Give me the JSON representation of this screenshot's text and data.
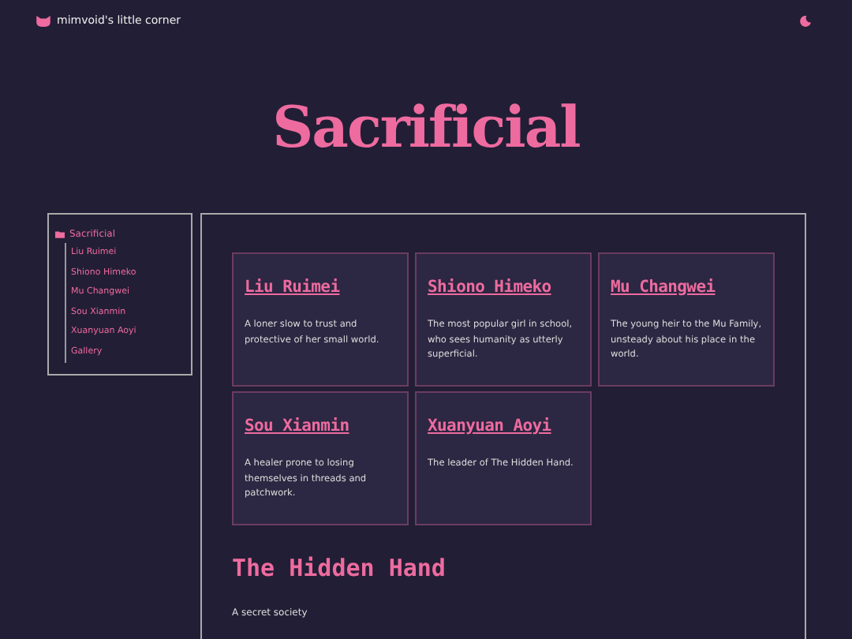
{
  "header": {
    "site_title": "mimvoid's little corner"
  },
  "page_title": "Sacrificial",
  "sidebar": {
    "items": [
      {
        "label": "Sacrificial",
        "children": [
          {
            "label": "Liu Ruimei"
          },
          {
            "label": "Shiono Himeko"
          },
          {
            "label": "Mu Changwei"
          },
          {
            "label": "Sou Xianmin"
          },
          {
            "label": "Xuanyuan Aoyi"
          },
          {
            "label": "Gallery"
          }
        ]
      }
    ]
  },
  "cards": [
    {
      "name": "Liu Ruimei",
      "description": "A loner slow to trust and protective of her small world."
    },
    {
      "name": "Shiono Himeko",
      "description": "The most popular girl in school, who sees humanity as utterly superficial."
    },
    {
      "name": "Mu Changwei",
      "description": "The young heir to the Mu Family, unsteady about his place in the world."
    },
    {
      "name": "Sou Xianmin",
      "description": "A healer prone to losing themselves in threads and patchwork."
    },
    {
      "name": "Xuanyuan Aoyi",
      "description": "The leader of The Hidden Hand."
    }
  ],
  "section": {
    "heading": "The Hidden Hand",
    "text": "A secret society"
  }
}
